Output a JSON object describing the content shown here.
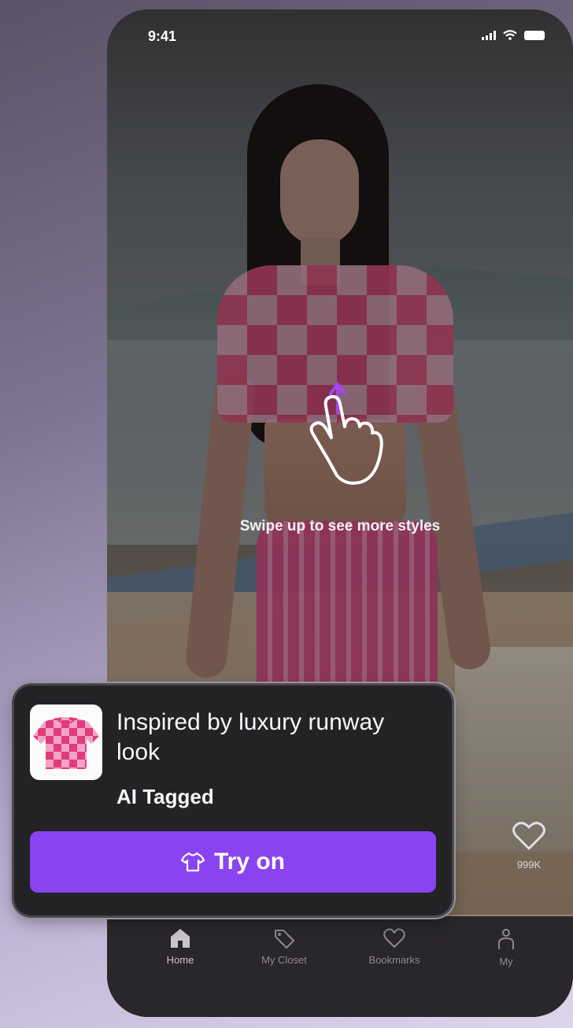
{
  "status_bar": {
    "time": "9:41"
  },
  "hint": {
    "text": "Swipe up to see more styles"
  },
  "like": {
    "count": "999K"
  },
  "card": {
    "title": "Inspired by luxury runway look",
    "tag": "AI Tagged",
    "button_label": "Try on",
    "button_color": "#8a43f0"
  },
  "tabs": [
    {
      "label": "Home",
      "icon": "home-icon",
      "active": true
    },
    {
      "label": "My Closet",
      "icon": "tag-icon",
      "active": false
    },
    {
      "label": "Bookmarks",
      "icon": "heart-icon",
      "active": false
    },
    {
      "label": "My",
      "icon": "person-icon",
      "active": false
    }
  ]
}
